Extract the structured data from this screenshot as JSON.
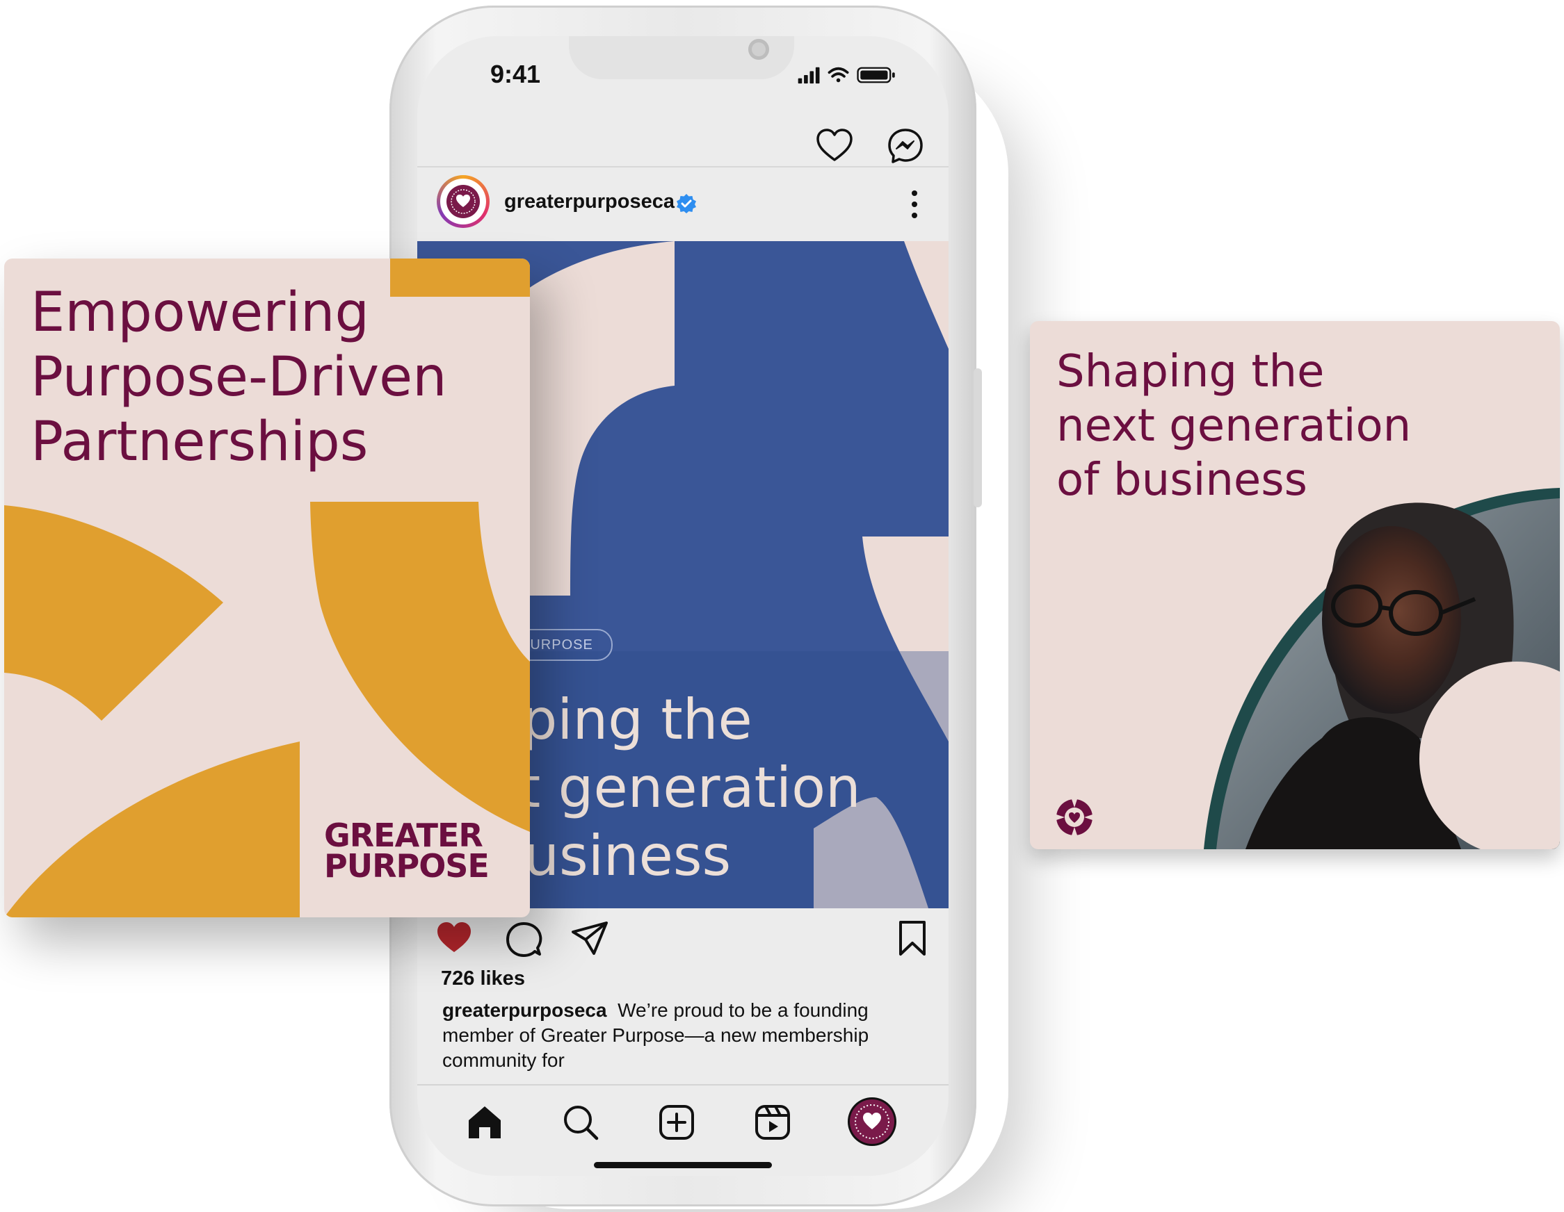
{
  "phone": {
    "status_time": "9:41",
    "post": {
      "username": "greaterpurposeca",
      "tag": "PURPOSE",
      "image_title": "Shaping the\nnext generation\nof business",
      "likes": "726 likes",
      "caption_user": "greaterpurposeca",
      "caption_text": "We’re proud to be a founding member of Greater Purpose—a new membership community for"
    },
    "header_icons": [
      "heart-icon",
      "messenger-icon"
    ],
    "post_actions": [
      "heart-filled-icon",
      "comment-icon",
      "share-icon",
      "bookmark-icon"
    ],
    "tab_bar": [
      "home-icon",
      "search-icon",
      "add-post-icon",
      "reels-icon",
      "profile-icon"
    ]
  },
  "left_card": {
    "title": "Empowering\nPurpose-Driven\nPartnerships",
    "brand_line1": "GREATER",
    "brand_line2": "PURPOSE"
  },
  "right_card": {
    "title": "Shaping the\nnext generation\nof business"
  },
  "colors": {
    "brand_plum": "#6b0f40",
    "blush": "#ecdcd7",
    "mustard": "#e09f2f",
    "blue": "#3a5697",
    "like_red": "#b3262c"
  }
}
